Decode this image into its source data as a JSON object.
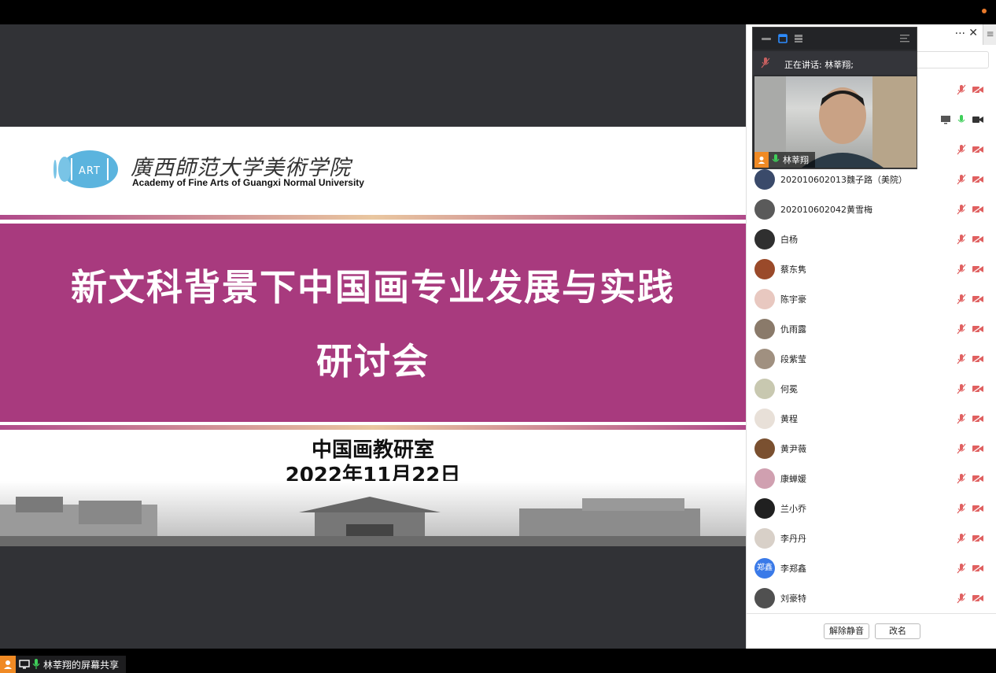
{
  "slide": {
    "logo_mark": "ART",
    "logo_cn": "廣西師范大学美術学院",
    "logo_en": "Academy of Fine Arts of Guangxi Normal University",
    "title_line1": "新文科背景下中国画专业发展与实践",
    "title_line2": "研讨会",
    "subtitle_line1": "中国画教研室",
    "subtitle_line2": "2022年11月22日"
  },
  "share_bar": {
    "label": "林莘翔的屏幕共享"
  },
  "video_float": {
    "speaking_text": "正在讲话: 林莘翔;",
    "name": "林莘翔"
  },
  "participants": [
    {
      "name": "",
      "avatar_color": "#ffffff",
      "has_share": false
    },
    {
      "name": "",
      "avatar_color": "#ffffff",
      "has_share": true
    },
    {
      "name": "",
      "avatar_color": "#ffffff",
      "has_share": false
    },
    {
      "name": "202010602013魏子路（美院）",
      "avatar_color": "#3a4a6a",
      "has_share": false
    },
    {
      "name": "202010602042黄雪梅",
      "avatar_color": "#5a5a5a",
      "has_share": false
    },
    {
      "name": "白杨",
      "avatar_color": "#2f2f2f",
      "has_share": false
    },
    {
      "name": "蔡东隽",
      "avatar_color": "#9a4a2a",
      "has_share": false
    },
    {
      "name": "陈宇豪",
      "avatar_color": "#e8c8c0",
      "has_share": false
    },
    {
      "name": "仇雨露",
      "avatar_color": "#8a7a6a",
      "has_share": false
    },
    {
      "name": "段紫莹",
      "avatar_color": "#a09080",
      "has_share": false
    },
    {
      "name": "何冕",
      "avatar_color": "#c8c8b0",
      "has_share": false
    },
    {
      "name": "黄程",
      "avatar_color": "#e8e0d8",
      "has_share": false
    },
    {
      "name": "黄尹薇",
      "avatar_color": "#7a5030",
      "has_share": false
    },
    {
      "name": "康蝉媛",
      "avatar_color": "#d0a0b0",
      "has_share": false
    },
    {
      "name": "兰小乔",
      "avatar_color": "#202020",
      "has_share": false
    },
    {
      "name": "李丹丹",
      "avatar_color": "#d8d0c8",
      "has_share": false
    },
    {
      "name": "李郑鑫",
      "avatar_color": "#3a7ae8",
      "avatar_text": "郑鑫",
      "has_share": false
    },
    {
      "name": "刘豪特",
      "avatar_color": "#505050",
      "has_share": false
    }
  ],
  "footer": {
    "unmute_label": "解除静音",
    "rename_label": "改名"
  },
  "colors": {
    "band": "#a83a7e",
    "accent_orange": "#f08a24",
    "muted_red": "#e06060"
  }
}
